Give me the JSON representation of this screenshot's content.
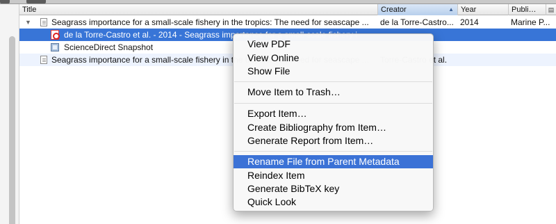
{
  "columns": {
    "title": "Title",
    "creator": "Creator",
    "year": "Year",
    "publication": "Publi…"
  },
  "rows": [
    {
      "title": "Seagrass importance for a small-scale fishery in the tropics: The need for seascape ...",
      "creator": "de la Torre-Castro...",
      "year": "2014",
      "publication": "Marine P..."
    },
    {
      "title": "de la Torre-Castro et al. - 2014 - Seagrass importance for a small-scale fishery i",
      "creator": "",
      "year": "",
      "publication": ""
    },
    {
      "title": "ScienceDirect Snapshot",
      "creator": "",
      "year": "",
      "publication": ""
    },
    {
      "title": "Seagrass importance for a small-scale fishery in the tropics: The need for seascape ...",
      "creator": "Torre-Castro et al.",
      "year": "",
      "publication": ""
    }
  ],
  "context_menu": {
    "items": [
      "View PDF",
      "View Online",
      "Show File",
      "Move Item to Trash…",
      "Export Item…",
      "Create Bibliography from Item…",
      "Generate Report from Item…",
      "Rename File from Parent Metadata",
      "Reindex Item",
      "Generate BibTeX key",
      "Quick Look"
    ],
    "highlighted": "Rename File from Parent Metadata"
  },
  "colors": {
    "selection": "#3875d7",
    "menu_highlight": "#3b72d6",
    "alt_row": "#edf3fe",
    "sorted_header": "#b7cfec"
  },
  "icons": {
    "twisty": "disclosure-triangle-icon",
    "item": "document-icon",
    "pdf": "pdf-attachment-icon",
    "snapshot": "web-snapshot-icon",
    "sort": "sort-ascending-icon",
    "column_picker": "column-picker-icon"
  }
}
